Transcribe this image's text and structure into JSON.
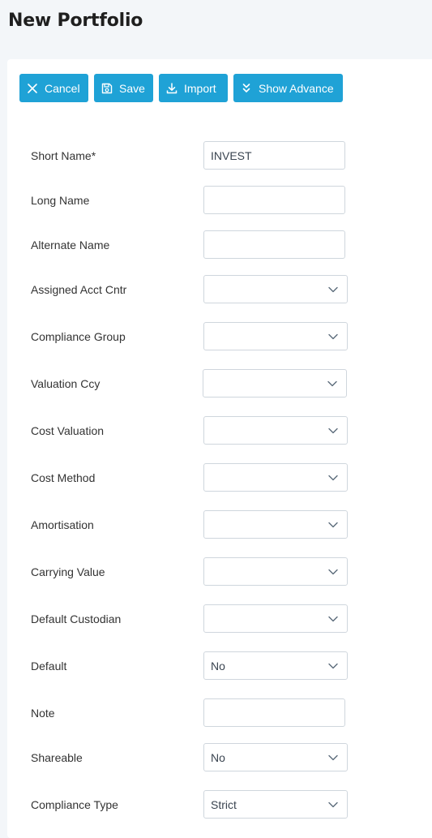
{
  "page": {
    "title": "New Portfolio"
  },
  "toolbar": {
    "cancel_label": "Cancel",
    "save_label": "Save",
    "import_label": "Import",
    "advance_label": "Show Advance"
  },
  "form": {
    "short_name": {
      "label": "Short Name*",
      "value": "INVEST"
    },
    "long_name": {
      "label": "Long Name",
      "value": ""
    },
    "alternate_name": {
      "label": "Alternate Name",
      "value": ""
    },
    "assigned_acct_cntr": {
      "label": "Assigned Acct Cntr",
      "value": ""
    },
    "compliance_group": {
      "label": "Compliance Group",
      "value": ""
    },
    "valuation_ccy": {
      "label": "Valuation Ccy",
      "value": ""
    },
    "cost_valuation": {
      "label": "Cost Valuation",
      "value": ""
    },
    "cost_method": {
      "label": "Cost Method",
      "value": ""
    },
    "amortisation": {
      "label": "Amortisation",
      "value": ""
    },
    "carrying_value": {
      "label": "Carrying Value",
      "value": ""
    },
    "default_custodian": {
      "label": "Default Custodian",
      "value": ""
    },
    "default": {
      "label": "Default",
      "value": "No"
    },
    "note": {
      "label": "Note",
      "value": ""
    },
    "shareable": {
      "label": "Shareable",
      "value": "No"
    },
    "compliance_type": {
      "label": "Compliance Type",
      "value": "Strict"
    }
  },
  "icons": {
    "cancel": "close-icon",
    "save": "save-icon",
    "import": "download-icon",
    "advance": "double-chevron-down-icon",
    "select": "chevron-down-icon"
  },
  "colors": {
    "accent": "#1fa2d6",
    "background": "#f3f6f9",
    "card": "#ffffff",
    "border": "#cfd6dd"
  }
}
